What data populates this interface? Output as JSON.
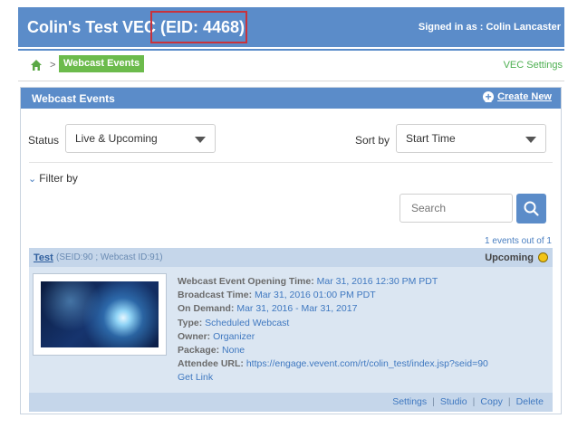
{
  "header": {
    "title": "Colin's Test VEC",
    "eid": "(EID: 4468)",
    "signed_in": "Signed in as : Colin Lancaster"
  },
  "breadcrumb": {
    "home_icon": "home-icon",
    "separator": ">",
    "current": "Webcast Events",
    "settings_link": "VEC Settings"
  },
  "panel": {
    "title": "Webcast Events",
    "create_new": "Create New"
  },
  "filters": {
    "status_label": "Status",
    "status_value": "Live & Upcoming",
    "sort_label": "Sort by",
    "sort_value": "Start Time",
    "filter_toggle": "Filter by",
    "search_placeholder": "Search"
  },
  "results": {
    "count_text": "1 events out of 1"
  },
  "event": {
    "name": "Test",
    "ids": "(SEID:90  ; Webcast ID:91)",
    "status": "Upcoming",
    "status_color": "#f2c416",
    "details": [
      {
        "label": "Webcast Event Opening Time:",
        "value": "Mar 31, 2016 12:30 PM PDT"
      },
      {
        "label": "Broadcast Time:",
        "value": "Mar 31, 2016 01:00 PM PDT"
      },
      {
        "label": "On Demand:",
        "value": "Mar 31, 2016 - Mar 31, 2017"
      },
      {
        "label": "Type:",
        "value": "Scheduled Webcast"
      },
      {
        "label": "Owner:",
        "value": "Organizer"
      },
      {
        "label": "Package:",
        "value": "None"
      },
      {
        "label": "Attendee URL:",
        "value": "https://engage.vevent.com/rt/colin_test/index.jsp?seid=90"
      }
    ],
    "get_link": "Get Link",
    "actions": [
      "Settings",
      "Studio",
      "Copy",
      "Delete"
    ]
  }
}
